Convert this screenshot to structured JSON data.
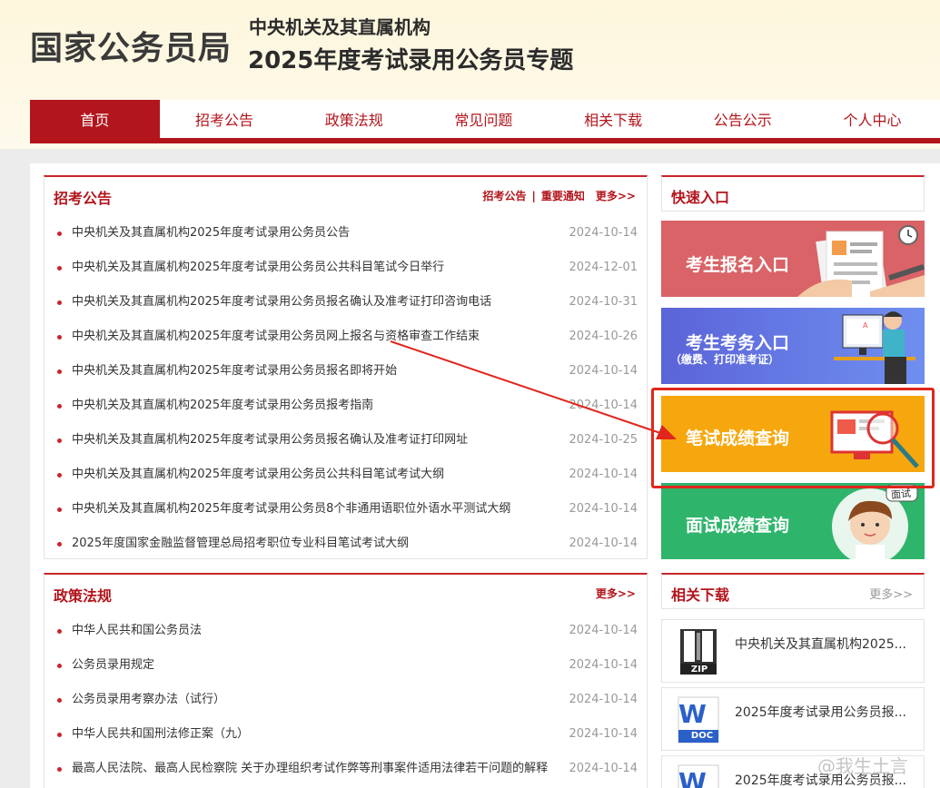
{
  "header": {
    "org": "国家公务员局",
    "subtitle1": "中央机关及其直属机构",
    "subtitle2": "2025年度考试录用公务员专题"
  },
  "nav": {
    "items": [
      "首页",
      "招考公告",
      "政策法规",
      "常见问题",
      "相关下载",
      "公告公示",
      "个人中心"
    ],
    "active": "首页"
  },
  "announcements": {
    "title": "招考公告",
    "link1": "招考公告",
    "sep": "|",
    "link2": "重要通知",
    "more": "更多>>",
    "items": [
      {
        "title": "中央机关及其直属机构2025年度考试录用公务员公告",
        "date": "2024-10-14"
      },
      {
        "title": "中央机关及其直属机构2025年度考试录用公务员公共科目笔试今日举行",
        "date": "2024-12-01"
      },
      {
        "title": "中央机关及其直属机构2025年度考试录用公务员报名确认及准考证打印咨询电话",
        "date": "2024-10-31"
      },
      {
        "title": "中央机关及其直属机构2025年度考试录用公务员网上报名与资格审查工作结束",
        "date": "2024-10-26"
      },
      {
        "title": "中央机关及其直属机构2025年度考试录用公务员报名即将开始",
        "date": "2024-10-14"
      },
      {
        "title": "中央机关及其直属机构2025年度考试录用公务员报考指南",
        "date": "2024-10-14"
      },
      {
        "title": "中央机关及其直属机构2025年度考试录用公务员报名确认及准考证打印网址",
        "date": "2024-10-25"
      },
      {
        "title": "中央机关及其直属机构2025年度考试录用公务员公共科目笔试考试大纲",
        "date": "2024-10-14"
      },
      {
        "title": "中央机关及其直属机构2025年度考试录用公务员8个非通用语职位外语水平测试大纲",
        "date": "2024-10-14"
      },
      {
        "title": "2025年度国家金融监督管理总局招考职位专业科目笔试考试大纲",
        "date": "2024-10-14"
      }
    ]
  },
  "policy": {
    "title": "政策法规",
    "more": "更多>>",
    "items": [
      {
        "title": "中华人民共和国公务员法",
        "date": "2024-10-14"
      },
      {
        "title": "公务员录用规定",
        "date": "2024-10-14"
      },
      {
        "title": "公务员录用考察办法（试行）",
        "date": "2024-10-14"
      },
      {
        "title": "中华人民共和国刑法修正案（九）",
        "date": "2024-10-14"
      },
      {
        "title": "最高人民法院、最高人民检察院 关于办理组织考试作弊等刑事案件适用法律若干问题的解释",
        "date": "2024-10-14"
      }
    ]
  },
  "quick": {
    "title": "快速入口",
    "register": "考生报名入口",
    "affairs": "考生考务入口",
    "affairs_sub": "（缴费、打印准考证）",
    "written": "笔试成绩查询",
    "interview": "面试成绩查询",
    "interview_tag": "面试"
  },
  "downloads": {
    "title": "相关下载",
    "more": "更多>>",
    "items": [
      {
        "name": "中央机关及其直属机构2025...",
        "type": "ZIP"
      },
      {
        "name": "2025年度考试录用公务员报...",
        "type": "DOC"
      },
      {
        "name": "2025年度考试录用公务员报...",
        "type": "DOC"
      }
    ]
  },
  "watermark": "@我生土言",
  "colors": {
    "brand": "#b3151c",
    "register": "#d96367",
    "affairs": "#5b64d8",
    "written": "#f6a70d",
    "interview": "#2fb46c",
    "highlight": "#e0261c"
  }
}
